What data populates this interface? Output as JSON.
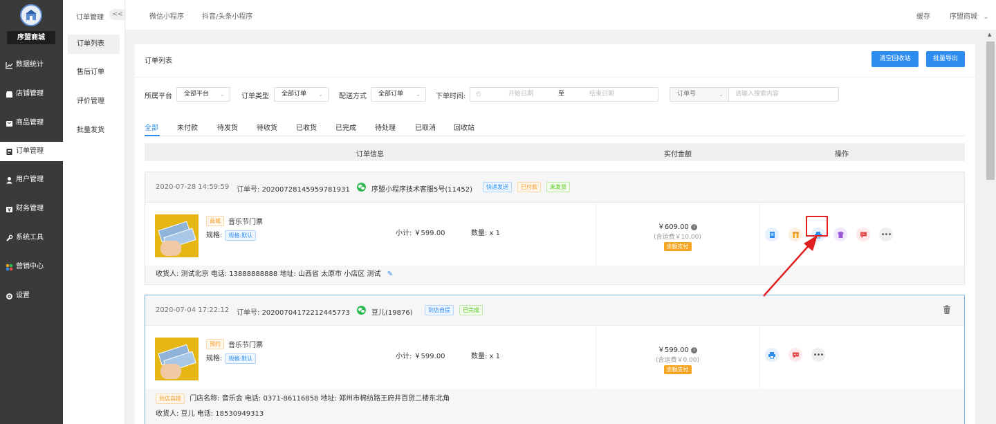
{
  "sidebar": {
    "shop_name": "序盟商城",
    "items": [
      {
        "label": "数据统计",
        "icon": "chart-line-icon"
      },
      {
        "label": "店铺管理",
        "icon": "store-icon"
      },
      {
        "label": "商品管理",
        "icon": "goods-icon"
      },
      {
        "label": "订单管理",
        "icon": "order-icon"
      },
      {
        "label": "用户管理",
        "icon": "user-icon"
      },
      {
        "label": "财务管理",
        "icon": "finance-icon"
      },
      {
        "label": "系统工具",
        "icon": "wrench-icon"
      },
      {
        "label": "营销中心",
        "icon": "marketing-icon"
      },
      {
        "label": "设置",
        "icon": "gear-icon"
      }
    ],
    "active_index": 3
  },
  "subnav": {
    "title": "订单管理",
    "collapse_label": "<<",
    "items": [
      "订单列表",
      "售后订单",
      "评价管理",
      "批量发货"
    ]
  },
  "topbar": {
    "nav": [
      "微信小程序",
      "抖音/头条小程序"
    ],
    "cache": "缓存",
    "user": "序盟商城",
    "user_chevron": "⌄"
  },
  "panel": {
    "title": "订单列表",
    "clear_bin_label": "清空回收站",
    "export_label": "批量导出"
  },
  "filters": {
    "platform_label": "所属平台",
    "platform_value": "全部平台",
    "type_label": "订单类型",
    "type_value": "全部订单",
    "delivery_label": "配送方式",
    "delivery_value": "全部订单",
    "time_label": "下单时间:",
    "start_placeholder": "开始日期",
    "to": "至",
    "end_placeholder": "结束日期",
    "search_field": "订单号",
    "search_placeholder": "请输入搜索内容"
  },
  "tabs": [
    "全部",
    "未付款",
    "待发货",
    "待收货",
    "已收货",
    "已完成",
    "待处理",
    "已取消",
    "回收站"
  ],
  "table_head": {
    "info": "订单信息",
    "amount": "实付金额",
    "ops": "操作"
  },
  "orders": [
    {
      "time": "2020-07-28 14:59:59",
      "order_no_label": "订单号:",
      "order_no": "20200728145959781931",
      "user": "序盟小程序技术客服5号(11452)",
      "tags": [
        "快递发送",
        "已付款",
        "未发货"
      ],
      "product_tag": "商城",
      "product_name": "音乐节门票",
      "spec_label": "规格:",
      "spec_value": "规格:默认",
      "subtotal": "小计: ￥599.00",
      "qty": "数量: x 1",
      "amount": "￥609.00",
      "shipping": "(含运费￥10.00)",
      "pay_method": "余额支付",
      "footer": "收货人: 测试北京 电话: 13888888888 地址: 山西省 太原市 小店区 测试"
    },
    {
      "time": "2020-07-04 17:22:12",
      "order_no_label": "订单号:",
      "order_no": "20200704172212445773",
      "user": "豆儿(19876)",
      "tags": [
        "到店自提",
        "已完成"
      ],
      "product_tag": "预约",
      "product_name": "音乐节门票",
      "spec_label": "规格:",
      "spec_value": "规格:默认",
      "subtotal": "小计: ￥599.00",
      "qty": "数量: x 1",
      "amount": "￥599.00",
      "shipping": "(含运费￥0.00)",
      "pay_method": "余额支付",
      "pickup_tag": "到店自提",
      "store_info": "门店名称: 音乐会 电话: 0371-86116858 地址: 郑州市棉纺路王府井百货二楼东北角",
      "footer": "收货人: 豆儿 电话: 18530949313"
    }
  ],
  "colors": {
    "primary": "#2d8cf0",
    "sidebar": "#3a3a3a",
    "callout": "#e02020",
    "wechat": "#2fba53"
  }
}
